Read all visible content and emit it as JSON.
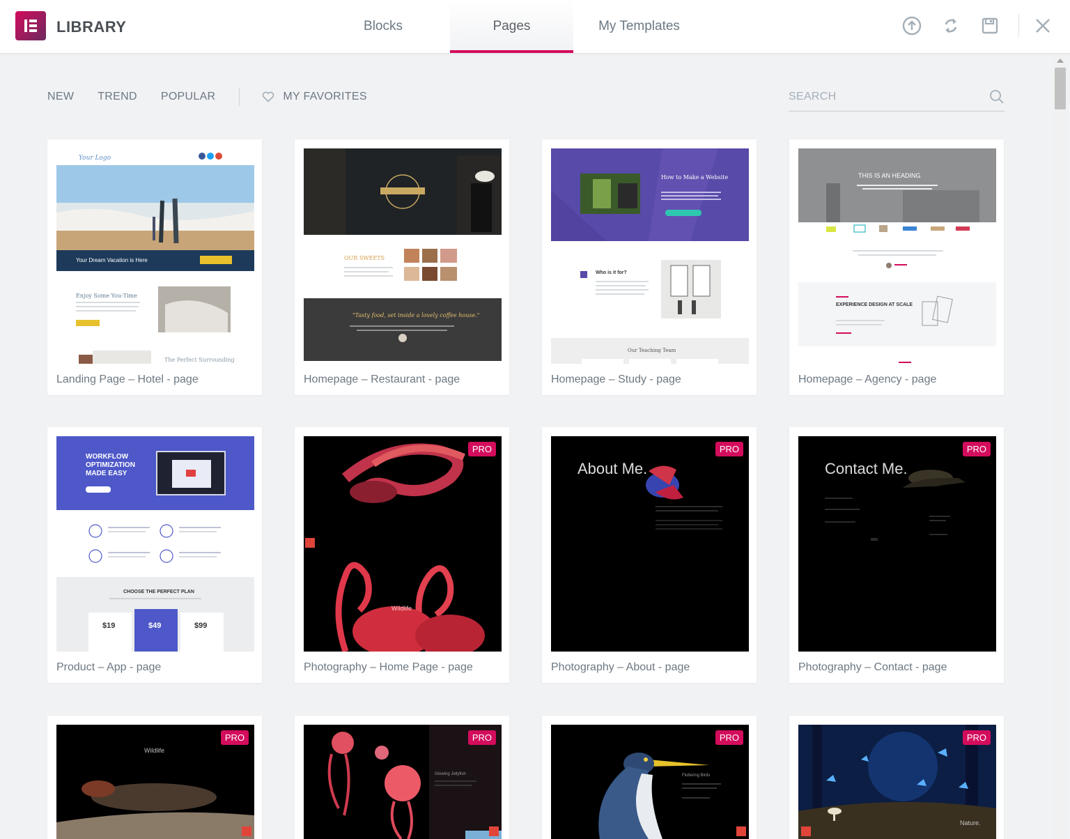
{
  "header": {
    "title": "LIBRARY",
    "tabs": [
      {
        "label": "Blocks"
      },
      {
        "label": "Pages"
      },
      {
        "label": "My Templates"
      }
    ],
    "icons": [
      "upload-icon",
      "sync-icon",
      "save-icon",
      "close-icon"
    ]
  },
  "filters": {
    "items": [
      {
        "label": "NEW"
      },
      {
        "label": "TREND"
      },
      {
        "label": "POPULAR"
      }
    ],
    "favorites": "MY FAVORITES",
    "search_placeholder": "SEARCH"
  },
  "badge": "PRO",
  "cards": [
    {
      "title": "Landing Page – Hotel - page",
      "pro": false,
      "text": [
        "Your Dream Vacation is Here",
        "Enjoy Some You-Time",
        "The Perfect Surrounding"
      ]
    },
    {
      "title": "Homepage – Restaurant - page",
      "pro": false,
      "text": [
        "OUR SWEETS",
        "\"Tasty food, set inside a lovely coffee house.\""
      ]
    },
    {
      "title": "Homepage – Study - page",
      "pro": false,
      "text": [
        "How to Make a Website",
        "Who is it for?",
        "Our Teaching Team"
      ]
    },
    {
      "title": "Homepage – Agency - page",
      "pro": false,
      "text": [
        "THIS IS AN HEADING",
        "EXPERIENCE DESIGN AT SCALE"
      ]
    },
    {
      "title": "Product – App - page",
      "pro": false,
      "text": [
        "WORKFLOW OPTIMIZATION MADE EASY",
        "CHOOSE THE PERFECT PLAN",
        "$19",
        "$49",
        "$99"
      ]
    },
    {
      "title": "Photography – Home Page - page",
      "pro": true,
      "text": [
        "Wildlife"
      ]
    },
    {
      "title": "Photography – About - page",
      "pro": true,
      "text": [
        "About Me."
      ]
    },
    {
      "title": "Photography – Contact - page",
      "pro": true,
      "text": [
        "Contact Me."
      ]
    },
    {
      "title": "",
      "pro": true,
      "text": [
        "Wildlife"
      ]
    },
    {
      "title": "",
      "pro": true,
      "text": [
        "Glowing Jellyfish"
      ]
    },
    {
      "title": "",
      "pro": true,
      "text": [
        "Fluttering Birds"
      ]
    },
    {
      "title": "",
      "pro": true,
      "text": [
        "Nature."
      ]
    }
  ],
  "colors": {
    "accent": "#d30c5c",
    "background": "#f1f2f4",
    "text": "#6d7882"
  }
}
